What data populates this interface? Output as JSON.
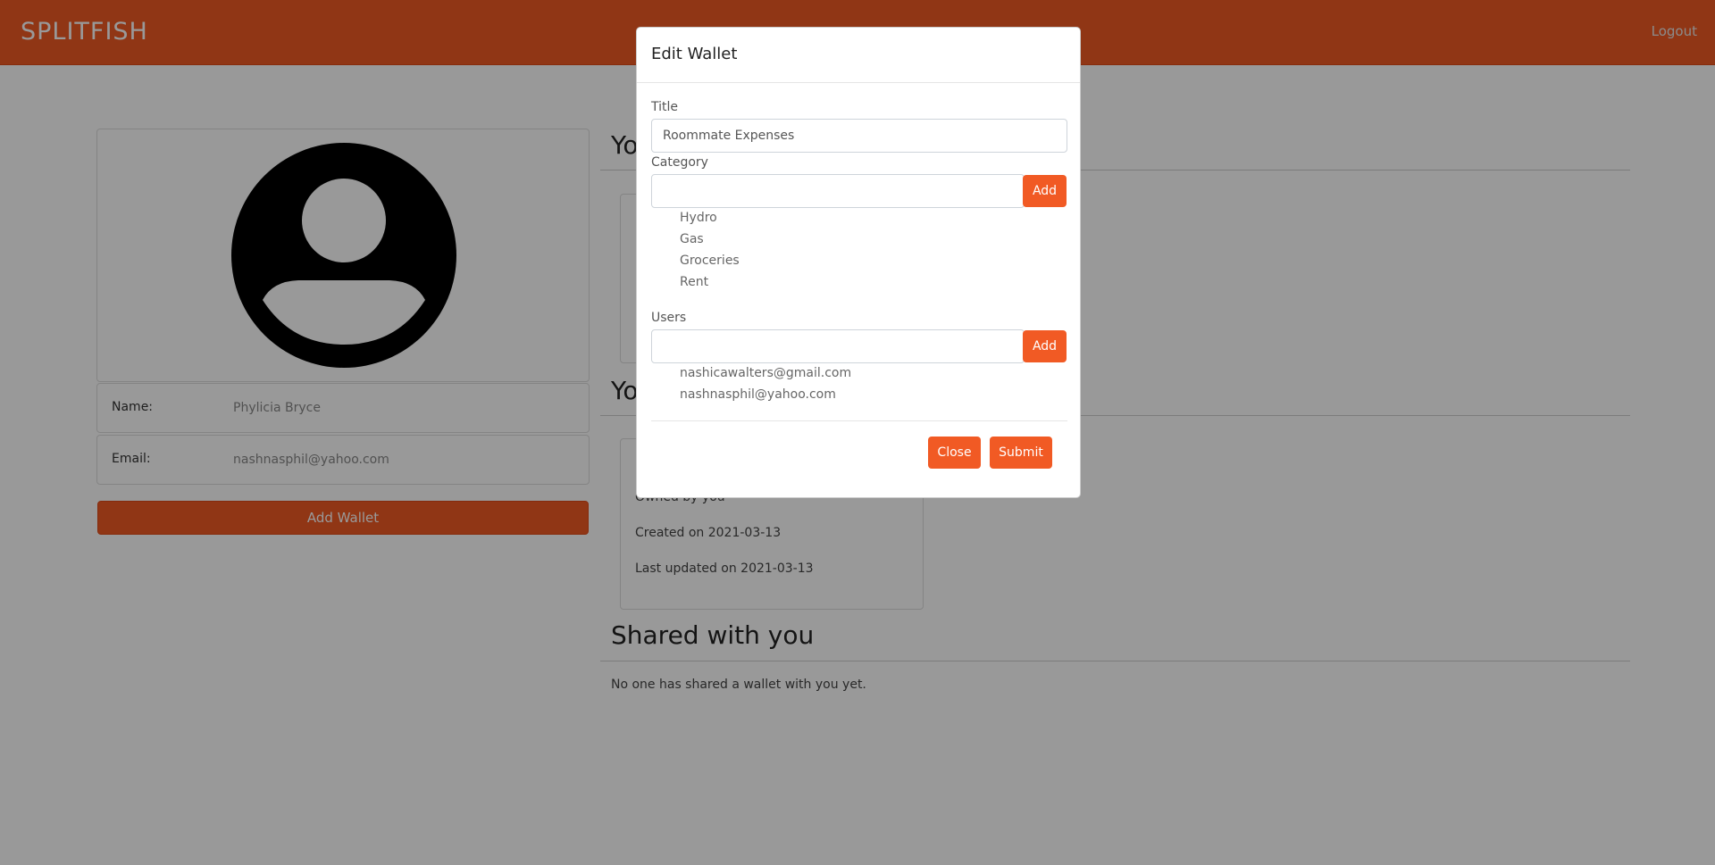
{
  "navbar": {
    "brand": "SPLITFISH",
    "logout": "Logout"
  },
  "profile": {
    "name_label": "Name:",
    "name_value": "Phylicia Bryce",
    "email_label": "Email:",
    "email_value": "nashnasphil@yahoo.com",
    "add_wallet_label": "Add Wallet"
  },
  "sections": {
    "wallets_title_partial": "Yo",
    "owned_title_partial": "Yo",
    "shared_title": "Shared with you",
    "shared_empty": "No one has shared a wallet with you yet."
  },
  "wallet_card": {
    "owner": "Owned by you",
    "created": "Created on 2021-03-13",
    "updated": "Last updated on 2021-03-13"
  },
  "modal": {
    "title": "Edit Wallet",
    "title_label": "Title",
    "title_value": "Roommate Expenses",
    "category_label": "Category",
    "category_add": "Add",
    "categories": [
      "Hydro",
      "Gas",
      "Groceries",
      "Rent"
    ],
    "users_label": "Users",
    "users_add": "Add",
    "users": [
      "nashicawalters@gmail.com",
      "nashnasphil@yahoo.com"
    ],
    "close_label": "Close",
    "submit_label": "Submit"
  },
  "colors": {
    "accent": "#f15a24",
    "backdrop": "rgba(0,0,0,0.4)"
  }
}
